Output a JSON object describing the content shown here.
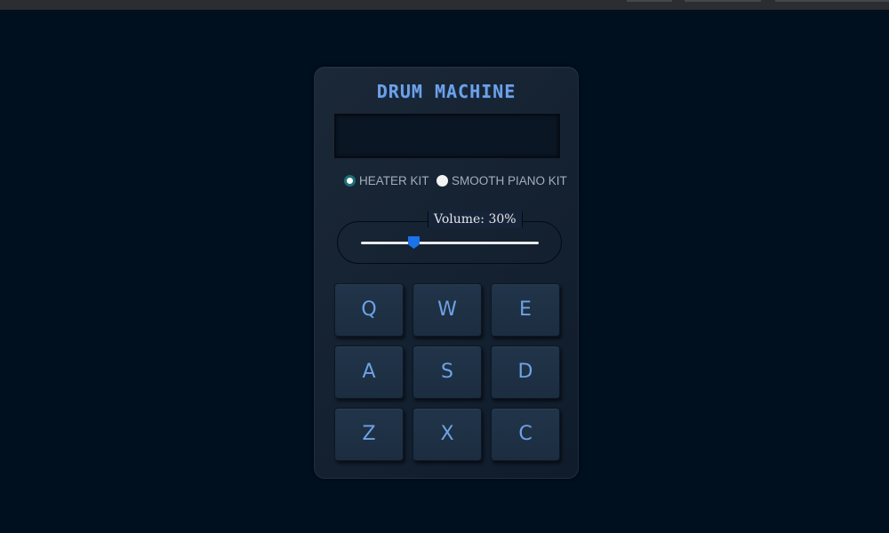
{
  "app": {
    "title": "DRUM MACHINE"
  },
  "display": {
    "text": ""
  },
  "kits": [
    {
      "label": "HEATER KIT",
      "checked": true
    },
    {
      "label": "SMOOTH PIANO KIT",
      "checked": false
    }
  ],
  "volume": {
    "label": "Volume: 30%",
    "value": 0.3
  },
  "pads": [
    {
      "key": "Q"
    },
    {
      "key": "W"
    },
    {
      "key": "E"
    },
    {
      "key": "A"
    },
    {
      "key": "S"
    },
    {
      "key": "D"
    },
    {
      "key": "Z"
    },
    {
      "key": "X"
    },
    {
      "key": "C"
    }
  ],
  "colors": {
    "background": "#00101f",
    "panel": "#16243a",
    "accent": "#6ea2e6",
    "slider_thumb": "#1a73e8"
  }
}
